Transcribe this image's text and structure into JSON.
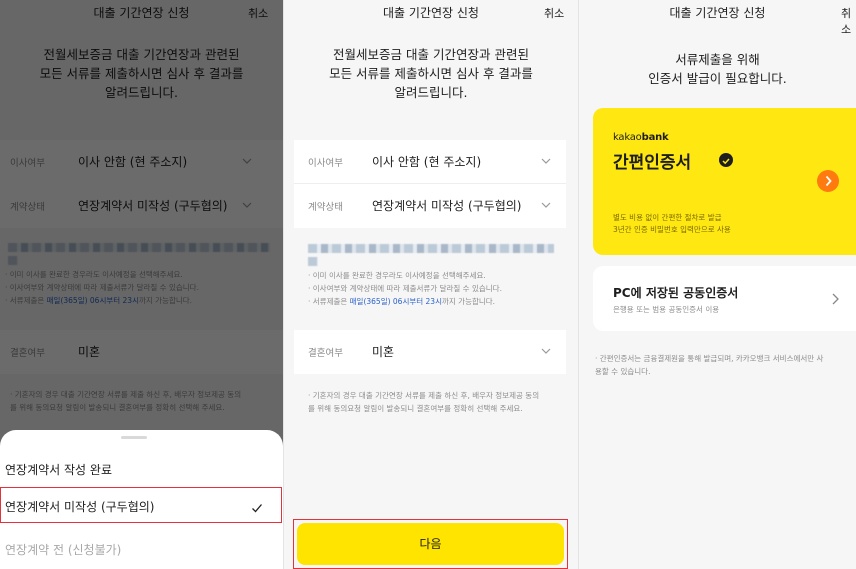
{
  "header": {
    "title": "대출 기간연장 신청",
    "cancel": "취소"
  },
  "intro": {
    "line1": "전월세보증금 대출 기간연장과 관련된",
    "line2": "모든 서류를 제출하시면 심사 후 결과를",
    "line3": "알려드립니다."
  },
  "form": {
    "move_label": "이사여부",
    "move_value": "이사 안함 (현 주소지)",
    "contract_label": "계약상태",
    "contract_value": "연장계약서 미작성 (구두협의)",
    "marriage_label": "결혼여부",
    "marriage_value": "미혼"
  },
  "notes": {
    "n1": "· 이미 이사를 완료한 경우라도 이사예정을 선택해주세요.",
    "n2": "· 이사여부와 계약상태에 따라 제출서류가 달라질 수 있습니다.",
    "n3_pre": "· 서류제출은 ",
    "n3_hl": "매일(365일) 06시부터 23시",
    "n3_post": "까지 가능합니다.",
    "marriage1": "· 기혼자의 경우 대출 기간연장 서류를 제출 하신 후, 배우자 정보제공 동의",
    "marriage2": "를 위해 동의요청 알림이 발송되니 결혼여부를 정확히 선택해 주세요."
  },
  "sheet": {
    "opt1": "연장계약서 작성 완료",
    "opt2": "연장계약서 미작성 (구두협의)",
    "opt3": "연장계약 전 (신청불가)"
  },
  "next_button": "다음",
  "cert": {
    "intro1": "서류제출을 위해",
    "intro2": "인증서 발급이 필요합니다.",
    "kakao_logo_prefix": "kakao",
    "kakao_logo_bold": "bank",
    "kakao_title": "간편인증서",
    "kakao_sub1": "별도 비용 없이 간편한 절차로 발급",
    "kakao_sub2": "3년간 인증 비밀번호 입력만으로 사용",
    "pc_title": "PC에 저장된 공동인증서",
    "pc_sub": "은행용 또는 범용 공동인증서 이용",
    "note1": "· 간편인증서는 금융결제원을 통해 발급되며, 카카오뱅크 서비스에서만 사",
    "note2": "용할 수 있습니다."
  },
  "colors": {
    "accent_yellow": "#ffe400",
    "kakao_card": "#ffe812",
    "highlight_red": "#e5313b",
    "link_blue": "#2b62c9",
    "arrow_orange": "#ff7a0f"
  }
}
